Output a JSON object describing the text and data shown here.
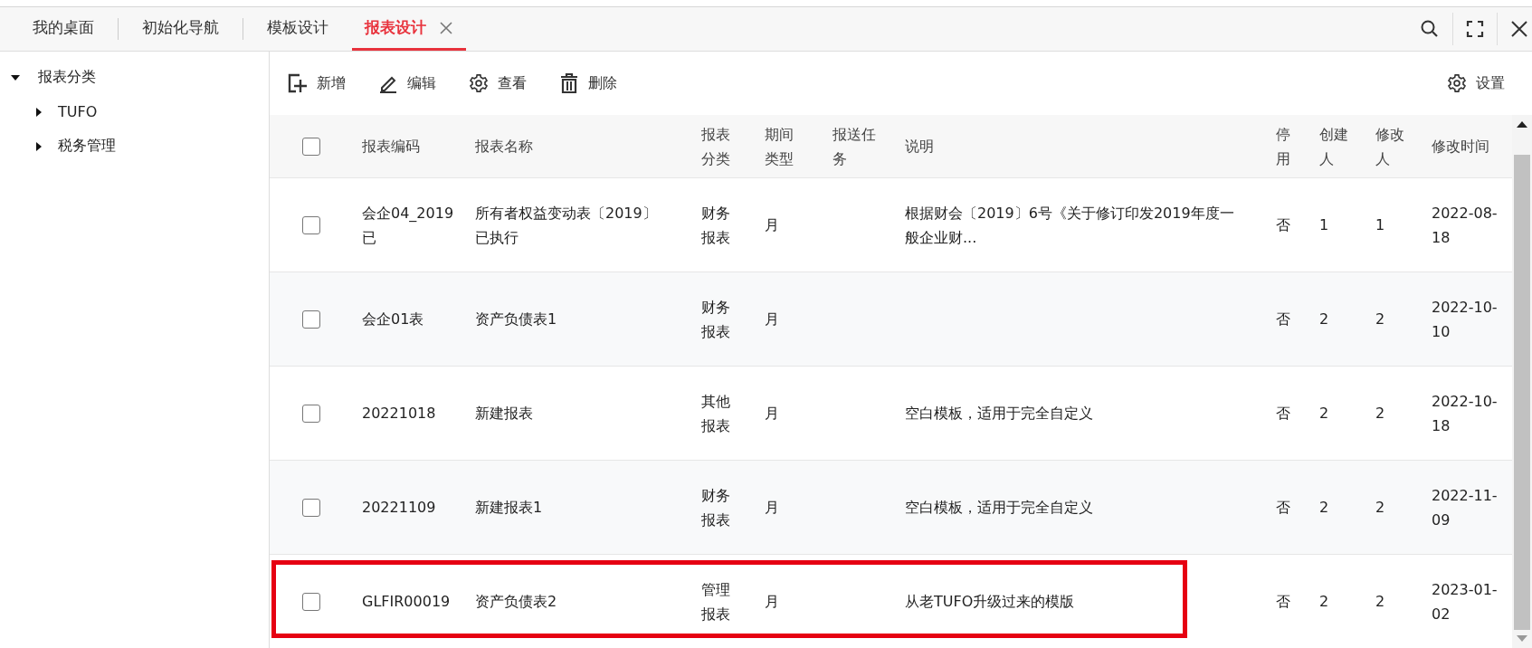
{
  "tabs": [
    {
      "label": "我的桌面",
      "selected": false,
      "closable": false
    },
    {
      "label": "初始化导航",
      "selected": false,
      "closable": false
    },
    {
      "label": "模板设计",
      "selected": false,
      "closable": false
    },
    {
      "label": "报表设计",
      "selected": true,
      "closable": true
    }
  ],
  "sidebar": {
    "tree": [
      {
        "label": "报表分类",
        "expanded": true,
        "children": [
          {
            "label": "TUFO",
            "expanded": false
          },
          {
            "label": "税务管理",
            "expanded": false
          }
        ]
      }
    ]
  },
  "toolbar": {
    "left": [
      {
        "label": "新增",
        "kind": "add"
      },
      {
        "label": "编辑",
        "kind": "edit"
      },
      {
        "label": "查看",
        "kind": "view"
      },
      {
        "label": "删除",
        "kind": "delete"
      }
    ],
    "right": [
      {
        "label": "设置",
        "kind": "settings"
      }
    ]
  },
  "table": {
    "header_checked": false,
    "columns": [
      "报表编码",
      "报表名称",
      "报表分类",
      "期间类型",
      "报送任务",
      "说明",
      "停用",
      "创建人",
      "修改人",
      "修改时间"
    ],
    "rows": [
      {
        "checked": false,
        "highlighted": false,
        "cells": [
          "会企04_2019已",
          "所有者权益变动表〔2019〕已执行",
          "财务报表",
          "月",
          "",
          "根据财会〔2019〕6号《关于修订印发2019年度一般企业财...",
          "否",
          "1",
          "1",
          "2022-08-18"
        ]
      },
      {
        "checked": false,
        "highlighted": false,
        "cells": [
          "会企01表",
          "资产负债表1",
          "财务报表",
          "月",
          "",
          "",
          "否",
          "2",
          "2",
          "2022-10-10"
        ]
      },
      {
        "checked": false,
        "highlighted": false,
        "cells": [
          "20221018",
          "新建报表",
          "其他报表",
          "月",
          "",
          "空白模板，适用于完全自定义",
          "否",
          "2",
          "2",
          "2022-10-18"
        ]
      },
      {
        "checked": false,
        "highlighted": false,
        "cells": [
          "20221109",
          "新建报表1",
          "财务报表",
          "月",
          "",
          "空白模板，适用于完全自定义",
          "否",
          "2",
          "2",
          "2022-11-09"
        ]
      },
      {
        "checked": false,
        "highlighted": true,
        "cells": [
          "GLFIR00019",
          "资产负债表2",
          "管理报表",
          "月",
          "",
          "从老TUFO升级过来的模版",
          "否",
          "2",
          "2",
          "2023-01-02"
        ]
      }
    ]
  }
}
